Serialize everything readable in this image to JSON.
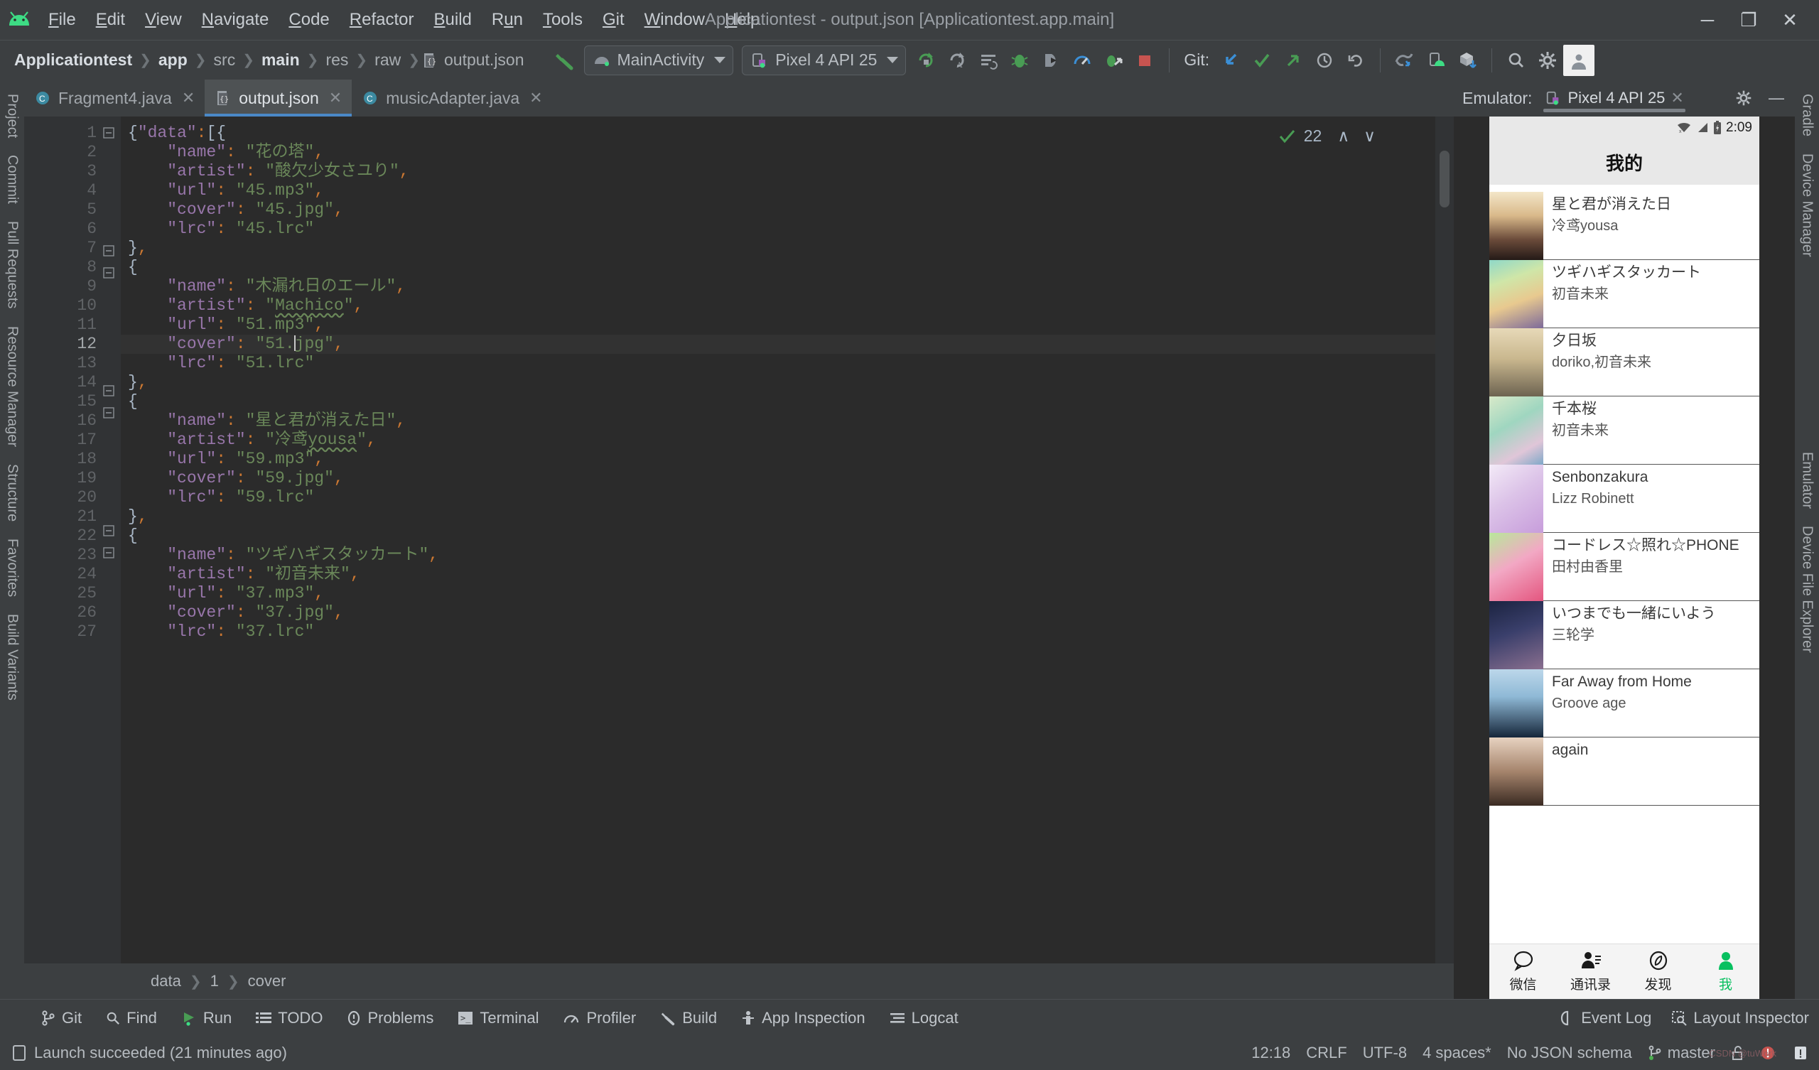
{
  "window": {
    "title": "Applicationtest - output.json [Applicationtest.app.main]",
    "minimize": "─",
    "maximize": "❐",
    "close": "✕"
  },
  "menu": {
    "items": [
      {
        "label": "File",
        "mnemonic": "F"
      },
      {
        "label": "Edit",
        "mnemonic": "E"
      },
      {
        "label": "View",
        "mnemonic": "V"
      },
      {
        "label": "Navigate",
        "mnemonic": "N"
      },
      {
        "label": "Code",
        "mnemonic": "C"
      },
      {
        "label": "Refactor",
        "mnemonic": "R"
      },
      {
        "label": "Build",
        "mnemonic": "B"
      },
      {
        "label": "Run",
        "mnemonic": "u"
      },
      {
        "label": "Tools",
        "mnemonic": "T"
      },
      {
        "label": "Git",
        "mnemonic": "G"
      },
      {
        "label": "Window",
        "mnemonic": "W"
      },
      {
        "label": "Help",
        "mnemonic": "H"
      }
    ]
  },
  "breadcrumbs": [
    "Applicationtest",
    "app",
    "src",
    "main",
    "res",
    "raw",
    "output.json"
  ],
  "toolbar": {
    "run_config": "MainActivity",
    "device": "Pixel 4 API 25",
    "git_label": "Git:",
    "icons": [
      "build-hammer-icon",
      "rerun-icon",
      "apply-changes-icon",
      "apply-code-changes-icon",
      "debug-icon",
      "run-tests-icon",
      "profiler-icon",
      "attach-debugger-icon",
      "stop-icon",
      "update-project-icon",
      "commit-icon",
      "push-icon",
      "history-icon",
      "undo-icon",
      "gradle-sync-icon",
      "avd-manager-icon",
      "sdk-manager-icon",
      "search-everywhere-icon",
      "settings-gear-icon",
      "avatar-icon"
    ]
  },
  "left_rail": [
    "Project",
    "Commit",
    "Pull Requests",
    "Resource Manager",
    "Structure",
    "Favorites",
    "Build Variants"
  ],
  "right_rail": [
    "Gradle",
    "Device Manager",
    "Emulator",
    "Device File Explorer"
  ],
  "editor_tabs": [
    {
      "label": "Fragment4.java",
      "icon": "java-class-icon",
      "active": false
    },
    {
      "label": "output.json",
      "icon": "json-file-icon",
      "active": true
    },
    {
      "label": "musicAdapter.java",
      "icon": "java-class-icon",
      "active": false
    }
  ],
  "inspection": {
    "count": "22",
    "up": "∧",
    "down": "∨",
    "status_icon": "inspection-ok-icon"
  },
  "editor": {
    "cursor_line": 12,
    "lines": [
      {
        "n": 1,
        "fold": "minus",
        "tokens": [
          {
            "t": "{",
            "c": "br"
          },
          {
            "t": "\"data\"",
            "c": "k"
          },
          {
            "t": ":",
            "c": "colon"
          },
          {
            "t": "[{",
            "c": "br"
          }
        ]
      },
      {
        "n": 2,
        "tokens": [
          {
            "t": "    ",
            "c": "c"
          },
          {
            "t": "\"name\"",
            "c": "k"
          },
          {
            "t": ": ",
            "c": "colon"
          },
          {
            "t": "\"花の塔\"",
            "c": "s"
          },
          {
            "t": ",",
            "c": "p"
          }
        ]
      },
      {
        "n": 3,
        "tokens": [
          {
            "t": "    ",
            "c": "c"
          },
          {
            "t": "\"artist\"",
            "c": "k"
          },
          {
            "t": ": ",
            "c": "colon"
          },
          {
            "t": "\"酸欠少女さユり\"",
            "c": "s"
          },
          {
            "t": ",",
            "c": "p"
          }
        ]
      },
      {
        "n": 4,
        "tokens": [
          {
            "t": "    ",
            "c": "c"
          },
          {
            "t": "\"url\"",
            "c": "k"
          },
          {
            "t": ": ",
            "c": "colon"
          },
          {
            "t": "\"45.mp3\"",
            "c": "s"
          },
          {
            "t": ",",
            "c": "p"
          }
        ]
      },
      {
        "n": 5,
        "tokens": [
          {
            "t": "    ",
            "c": "c"
          },
          {
            "t": "\"cover\"",
            "c": "k"
          },
          {
            "t": ": ",
            "c": "colon"
          },
          {
            "t": "\"45.jpg\"",
            "c": "s"
          },
          {
            "t": ",",
            "c": "p"
          }
        ]
      },
      {
        "n": 6,
        "tokens": [
          {
            "t": "    ",
            "c": "c"
          },
          {
            "t": "\"lrc\"",
            "c": "k"
          },
          {
            "t": ": ",
            "c": "colon"
          },
          {
            "t": "\"45.lrc\"",
            "c": "s"
          }
        ]
      },
      {
        "n": 7,
        "fold": "plus",
        "tokens": [
          {
            "t": "}",
            "c": "br"
          },
          {
            "t": ",",
            "c": "p"
          }
        ]
      },
      {
        "n": 8,
        "fold": "minus",
        "tokens": [
          {
            "t": "{",
            "c": "br"
          }
        ]
      },
      {
        "n": 9,
        "tokens": [
          {
            "t": "    ",
            "c": "c"
          },
          {
            "t": "\"name\"",
            "c": "k"
          },
          {
            "t": ": ",
            "c": "colon"
          },
          {
            "t": "\"木漏れ日のエール\"",
            "c": "s"
          },
          {
            "t": ",",
            "c": "p"
          }
        ]
      },
      {
        "n": 10,
        "tokens": [
          {
            "t": "    ",
            "c": "c"
          },
          {
            "t": "\"artist\"",
            "c": "k"
          },
          {
            "t": ": ",
            "c": "colon"
          },
          {
            "t": "\"",
            "c": "s"
          },
          {
            "t": "Machico",
            "c": "s squig"
          },
          {
            "t": "\"",
            "c": "s"
          },
          {
            "t": ",",
            "c": "p"
          }
        ]
      },
      {
        "n": 11,
        "tokens": [
          {
            "t": "    ",
            "c": "c"
          },
          {
            "t": "\"url\"",
            "c": "k"
          },
          {
            "t": ": ",
            "c": "colon"
          },
          {
            "t": "\"51.mp3\"",
            "c": "s"
          },
          {
            "t": ",",
            "c": "p"
          }
        ]
      },
      {
        "n": 12,
        "bulb": true,
        "current": true,
        "tokens": [
          {
            "t": "    ",
            "c": "c"
          },
          {
            "t": "\"cover\"",
            "c": "k"
          },
          {
            "t": ": ",
            "c": "colon"
          },
          {
            "t": "\"51.",
            "c": "s"
          },
          {
            "t": "CARET",
            "c": "caret"
          },
          {
            "t": "jpg\"",
            "c": "s"
          },
          {
            "t": ",",
            "c": "p"
          }
        ]
      },
      {
        "n": 13,
        "tokens": [
          {
            "t": "    ",
            "c": "c"
          },
          {
            "t": "\"lrc\"",
            "c": "k"
          },
          {
            "t": ": ",
            "c": "colon"
          },
          {
            "t": "\"51.lrc\"",
            "c": "s"
          }
        ]
      },
      {
        "n": 14,
        "fold": "plus",
        "tokens": [
          {
            "t": "}",
            "c": "br"
          },
          {
            "t": ",",
            "c": "p"
          }
        ]
      },
      {
        "n": 15,
        "fold": "minus",
        "tokens": [
          {
            "t": "{",
            "c": "br"
          }
        ]
      },
      {
        "n": 16,
        "tokens": [
          {
            "t": "    ",
            "c": "c"
          },
          {
            "t": "\"name\"",
            "c": "k"
          },
          {
            "t": ": ",
            "c": "colon"
          },
          {
            "t": "\"星と君が消えた日\"",
            "c": "s"
          },
          {
            "t": ",",
            "c": "p"
          }
        ]
      },
      {
        "n": 17,
        "tokens": [
          {
            "t": "    ",
            "c": "c"
          },
          {
            "t": "\"artist\"",
            "c": "k"
          },
          {
            "t": ": ",
            "c": "colon"
          },
          {
            "t": "\"冷鸢",
            "c": "s"
          },
          {
            "t": "yousa",
            "c": "s squig"
          },
          {
            "t": "\"",
            "c": "s"
          },
          {
            "t": ",",
            "c": "p"
          }
        ]
      },
      {
        "n": 18,
        "tokens": [
          {
            "t": "    ",
            "c": "c"
          },
          {
            "t": "\"url\"",
            "c": "k"
          },
          {
            "t": ": ",
            "c": "colon"
          },
          {
            "t": "\"59.mp3\"",
            "c": "s"
          },
          {
            "t": ",",
            "c": "p"
          }
        ]
      },
      {
        "n": 19,
        "tokens": [
          {
            "t": "    ",
            "c": "c"
          },
          {
            "t": "\"cover\"",
            "c": "k"
          },
          {
            "t": ": ",
            "c": "colon"
          },
          {
            "t": "\"59.jpg\"",
            "c": "s"
          },
          {
            "t": ",",
            "c": "p"
          }
        ]
      },
      {
        "n": 20,
        "tokens": [
          {
            "t": "    ",
            "c": "c"
          },
          {
            "t": "\"lrc\"",
            "c": "k"
          },
          {
            "t": ": ",
            "c": "colon"
          },
          {
            "t": "\"59.lrc\"",
            "c": "s"
          }
        ]
      },
      {
        "n": 21,
        "fold": "plus",
        "tokens": [
          {
            "t": "}",
            "c": "br"
          },
          {
            "t": ",",
            "c": "p"
          }
        ]
      },
      {
        "n": 22,
        "fold": "minus",
        "tokens": [
          {
            "t": "{",
            "c": "br"
          }
        ]
      },
      {
        "n": 23,
        "tokens": [
          {
            "t": "    ",
            "c": "c"
          },
          {
            "t": "\"name\"",
            "c": "k"
          },
          {
            "t": ": ",
            "c": "colon"
          },
          {
            "t": "\"ツギハギスタッカート\"",
            "c": "s"
          },
          {
            "t": ",",
            "c": "p"
          }
        ]
      },
      {
        "n": 24,
        "tokens": [
          {
            "t": "    ",
            "c": "c"
          },
          {
            "t": "\"artist\"",
            "c": "k"
          },
          {
            "t": ": ",
            "c": "colon"
          },
          {
            "t": "\"初音未来\"",
            "c": "s"
          },
          {
            "t": ",",
            "c": "p"
          }
        ]
      },
      {
        "n": 25,
        "tokens": [
          {
            "t": "    ",
            "c": "c"
          },
          {
            "t": "\"url\"",
            "c": "k"
          },
          {
            "t": ": ",
            "c": "colon"
          },
          {
            "t": "\"37.mp3\"",
            "c": "s"
          },
          {
            "t": ",",
            "c": "p"
          }
        ]
      },
      {
        "n": 26,
        "tokens": [
          {
            "t": "    ",
            "c": "c"
          },
          {
            "t": "\"cover\"",
            "c": "k"
          },
          {
            "t": ": ",
            "c": "colon"
          },
          {
            "t": "\"37.jpg\"",
            "c": "s"
          },
          {
            "t": ",",
            "c": "p"
          }
        ]
      },
      {
        "n": 27,
        "tokens": [
          {
            "t": "    ",
            "c": "c"
          },
          {
            "t": "\"lrc\"",
            "c": "k"
          },
          {
            "t": ": ",
            "c": "colon"
          },
          {
            "t": "\"37.lrc\"",
            "c": "s"
          }
        ]
      }
    ]
  },
  "editor_breadcrumbs": [
    "data",
    "1",
    "cover"
  ],
  "emulator": {
    "panel_label": "Emulator:",
    "tab_label": "Pixel 4 API 25",
    "close": "✕",
    "settings_icon": "gear-icon",
    "minimize_icon": "minimize-icon",
    "phone": {
      "status": {
        "time": "2:09",
        "wifi_icon": "wifi-off-icon",
        "signal_icon": "signal-icon",
        "battery_icon": "battery-charging-icon"
      },
      "appbar_title": "我的",
      "songs": [
        {
          "name": "星と君が消えた日",
          "artist": "冷鸢yousa",
          "cover": "crowd-concert"
        },
        {
          "name": "ツギハギスタッカート",
          "artist": "初音未来",
          "cover": "vocalo-fantasy"
        },
        {
          "name": "夕日坂",
          "artist": "doriko,初音未来",
          "cover": "sunset-street"
        },
        {
          "name": "千本桜",
          "artist": "初音未来",
          "cover": "senbon-anime"
        },
        {
          "name": "Senbonzakura",
          "artist": "Lizz Robinett",
          "cover": "senbonzakura-lizz"
        },
        {
          "name": "コードレス☆照れ☆PHONE",
          "artist": "田村由香里",
          "cover": "cordless-pink"
        },
        {
          "name": "いつまでも一緒にいよう",
          "artist": "三轮学",
          "cover": "night-anime"
        },
        {
          "name": "Far Away from Home",
          "artist": "Groove age",
          "cover": "groove-coverage"
        },
        {
          "name": "again",
          "artist": "",
          "cover": "again-girl"
        }
      ],
      "bottom_nav": [
        {
          "label": "微信",
          "icon": "chat-bubble-icon",
          "active": false
        },
        {
          "label": "通讯录",
          "icon": "contacts-icon",
          "active": false
        },
        {
          "label": "发现",
          "icon": "compass-icon",
          "active": false
        },
        {
          "label": "我",
          "icon": "person-icon",
          "active": true
        }
      ],
      "sysnav": {
        "back": "back-icon",
        "home": "home-icon",
        "recents": "recents-icon"
      }
    }
  },
  "bottom_tools": [
    {
      "label": "Git",
      "icon": "git-branch-icon"
    },
    {
      "label": "Find",
      "icon": "search-icon"
    },
    {
      "label": "Run",
      "icon": "run-play-icon"
    },
    {
      "label": "TODO",
      "icon": "todo-list-icon"
    },
    {
      "label": "Problems",
      "icon": "problems-icon"
    },
    {
      "label": "Terminal",
      "icon": "terminal-icon"
    },
    {
      "label": "Profiler",
      "icon": "profiler-icon"
    },
    {
      "label": "Build",
      "icon": "build-hammer-icon"
    },
    {
      "label": "App Inspection",
      "icon": "app-inspection-icon"
    },
    {
      "label": "Logcat",
      "icon": "logcat-icon"
    }
  ],
  "bottom_tools_right": [
    {
      "label": "Event Log",
      "icon": "event-log-icon"
    },
    {
      "label": "Layout Inspector",
      "icon": "layout-inspector-icon"
    }
  ],
  "status": {
    "message": "Launch succeeded (21 minutes ago)",
    "message_icon": "notification-icon",
    "caret_position": "12:18",
    "line_separator": "CRLF",
    "encoding": "UTF-8",
    "indent": "4 spaces*",
    "schema": "No JSON schema",
    "branch": "master",
    "branch_icon": "git-branch-icon",
    "lock_icon": "unlocked-icon",
    "error_badge": "error-notification-icon",
    "info_badge": "info-notification-icon",
    "watermark": "CSDN @tuWork"
  },
  "colors": {
    "accent_blue": "#4a88c7",
    "android_green": "#3ddc84",
    "string_green": "#6a8759",
    "key_purple": "#9876aa",
    "punct_orange": "#cc7832",
    "stop_red": "#c75450"
  }
}
